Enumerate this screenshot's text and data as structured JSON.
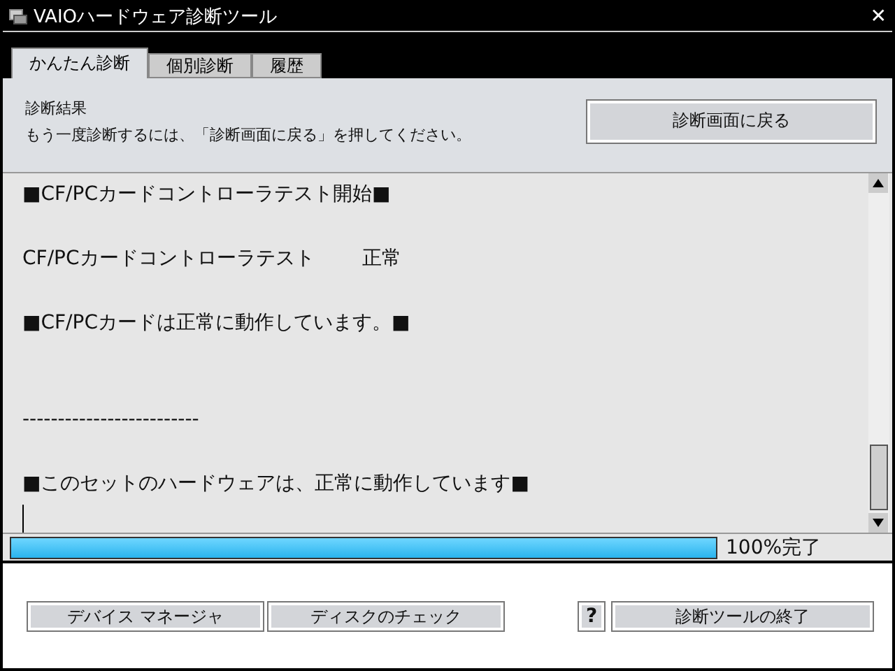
{
  "window": {
    "title": "VAIOハードウェア診断ツール",
    "close": "✕"
  },
  "tabs": [
    {
      "label": "かんたん診断",
      "selected": true
    },
    {
      "label": "個別診断",
      "selected": false
    },
    {
      "label": "履歴",
      "selected": false
    }
  ],
  "header": {
    "title": "診断結果",
    "hint": "もう一度診断するには、「診断画面に戻る」を押してください。",
    "button": "診断画面に戻る"
  },
  "log": [
    {
      "kind": "heading",
      "text": "■CF/PCカードコントローラテスト開始■"
    },
    {
      "kind": "result",
      "text": "CF/PCカードコントローラテスト",
      "status": "正常"
    },
    {
      "kind": "heading",
      "text": "■CF/PCカードは正常に動作しています。■"
    },
    {
      "kind": "separator",
      "text": "-------------------------"
    },
    {
      "kind": "heading",
      "text": "■このセットのハードウェアは、正常に動作しています■"
    }
  ],
  "progress": {
    "level": 1,
    "reading": "100%完了"
  },
  "buttons": {
    "left": [
      "デバイス マネージャ",
      "ディスクのチェック"
    ],
    "help": "?",
    "exit": "診断ツールの終了"
  }
}
